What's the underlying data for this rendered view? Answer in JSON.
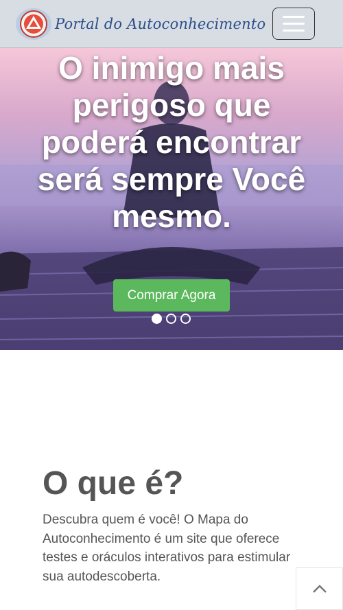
{
  "header": {
    "brand_text": "Portal do Autoconhecimento",
    "logo_icon": "portal-logo-icon",
    "menu_icon": "hamburger-menu-icon"
  },
  "hero": {
    "title": "O inimigo mais perigoso que poderá encontrar será sempre Você mesmo.",
    "cta_label": "Comprar Agora",
    "carousel": {
      "slides": 3,
      "active": 1
    }
  },
  "about": {
    "title": "O que é?",
    "description": "Descubra quem é você! O Mapa do Autoconhecimento é um site que oferece testes e oráculos interativos para estimular sua autodescoberta."
  },
  "scroll_top": {
    "icon": "chevron-up-icon"
  },
  "colors": {
    "header_bg": "#d7dde3",
    "brand_text": "#2c4f8a",
    "cta_bg": "#5cb85c",
    "body_text": "#555555"
  }
}
